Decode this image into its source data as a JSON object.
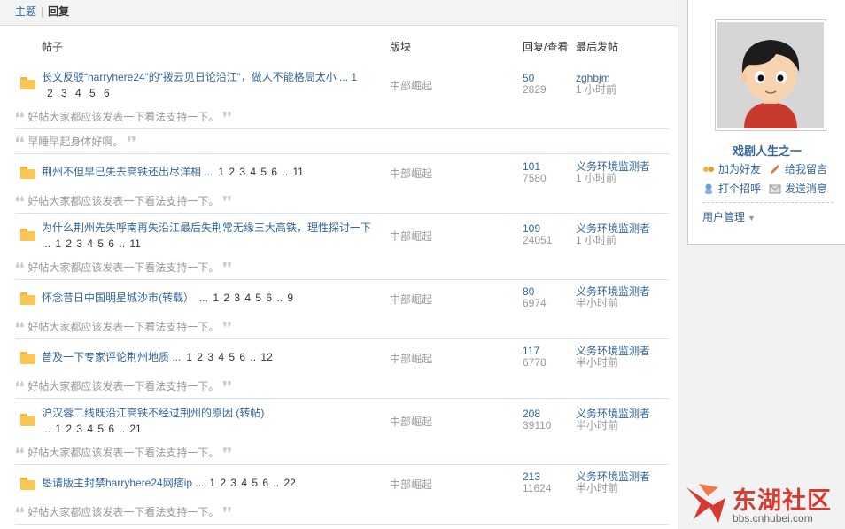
{
  "tabs": {
    "topics": "主题",
    "sep": "|",
    "replies": "回复"
  },
  "headers": {
    "post": "帖子",
    "forum": "版块",
    "stats": "回复/查看",
    "last": "最后发帖"
  },
  "threads": [
    {
      "title": "长文反驳“harryhere24”的“拨云见日论沿江”，做人不能格局太小 ... 1",
      "pages": "2 3 4 5 6",
      "forum": "中部崛起",
      "replies": "50",
      "views": "2829",
      "last_user": "zghbjm",
      "last_time": "1 小时前",
      "reply": "好帖大家都应该发表一下看法支持一下。",
      "reply2": "早睡早起身体好啊。"
    },
    {
      "title": "荆州不但早已失去高铁还出尽洋相 ...",
      "pages": "1  2  3  4  5  6 .. 11",
      "forum": "中部崛起",
      "replies": "101",
      "views": "7580",
      "last_user": "义务环境监测者",
      "last_time": "1 小时前",
      "reply": "好帖大家都应该发表一下看法支持一下。"
    },
    {
      "title": "为什么荆州先失呼南再失沿江最后失荆常无缘三大高铁，理性探讨一下",
      "pages": "... 1  2  3  4  5  6 .. 11",
      "forum": "中部崛起",
      "replies": "109",
      "views": "24051",
      "last_user": "义务环境监测者",
      "last_time": "1 小时前",
      "reply": "好帖大家都应该发表一下看法支持一下。"
    },
    {
      "title": "怀念昔日中国明星城沙市(转载）",
      "pages": "...  1  2  3  4  5  6 .. 9",
      "forum": "中部崛起",
      "replies": "80",
      "views": "6974",
      "last_user": "义务环境监测者",
      "last_time": "半小时前",
      "reply": "好帖大家都应该发表一下看法支持一下。"
    },
    {
      "title": "普及一下专家评论荆州地质 ...",
      "pages": "1  2  3  4  5  6 .. 12",
      "forum": "中部崛起",
      "replies": "117",
      "views": "6778",
      "last_user": "义务环境监测者",
      "last_time": "半小时前",
      "reply": "好帖大家都应该发表一下看法支持一下。"
    },
    {
      "title": "沪汉蓉二线既沿江高铁不经过荆州的原因 (转帖)",
      "pages": "...  1  2  3  4  5  6 .. 21",
      "forum": "中部崛起",
      "replies": "208",
      "views": "39110",
      "last_user": "义务环境监测者",
      "last_time": "半小时前",
      "reply": "好帖大家都应该发表一下看法支持一下。"
    },
    {
      "title": "恳请版主封禁harryhere24网痞ip ...",
      "pages": "1  2  3  4  5  6 .. 22",
      "forum": "中部崛起",
      "replies": "213",
      "views": "11624",
      "last_user": "义务环境监测者",
      "last_time": "半小时前",
      "reply": "好帖大家都应该发表一下看法支持一下。"
    }
  ],
  "profile": {
    "name": "戏剧人生之一",
    "add_friend": "加为好友",
    "leave_msg": "给我留言",
    "greet": "打个招呼",
    "send_msg": "发送消息",
    "user_mgmt": "用户管理"
  },
  "logo": {
    "name": "东湖社区",
    "url": "bbs.cnhubei.com"
  },
  "colors": {
    "link": "#336699",
    "muted": "#999999",
    "folder": "#fbc656",
    "logo": "#d83a2f"
  }
}
